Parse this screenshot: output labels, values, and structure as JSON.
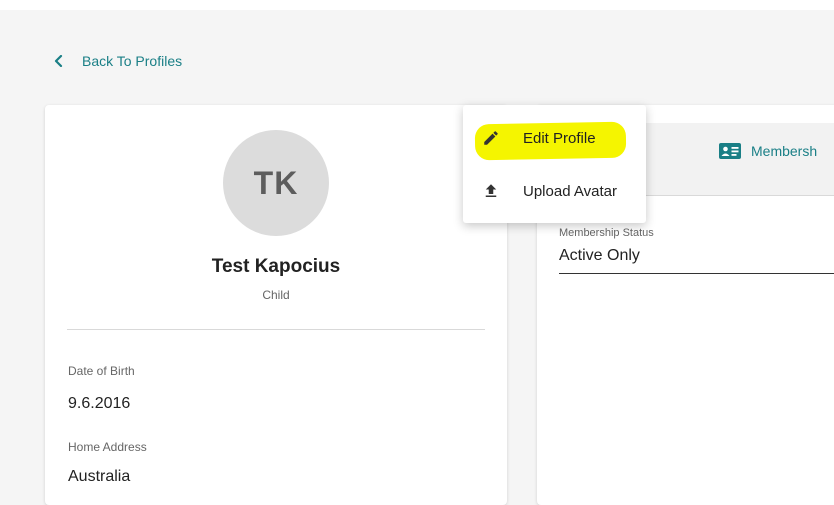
{
  "nav": {
    "back_label": "Back To Profiles"
  },
  "profile": {
    "initials": "TK",
    "name": "Test Kapocius",
    "role": "Child",
    "fields": [
      {
        "label": "Date of Birth",
        "value": "9.6.2016"
      },
      {
        "label": "Home Address",
        "value": "Australia"
      }
    ]
  },
  "right_panel": {
    "tab_label": "Membersh",
    "status_label": "Membership Status",
    "status_value": "Active Only"
  },
  "menu": {
    "items": [
      {
        "label": "Edit Profile",
        "icon": "pencil-icon"
      },
      {
        "label": "Upload Avatar",
        "icon": "upload-icon"
      }
    ]
  },
  "colors": {
    "accent": "#1a7f86",
    "highlight": "#f5f500"
  }
}
